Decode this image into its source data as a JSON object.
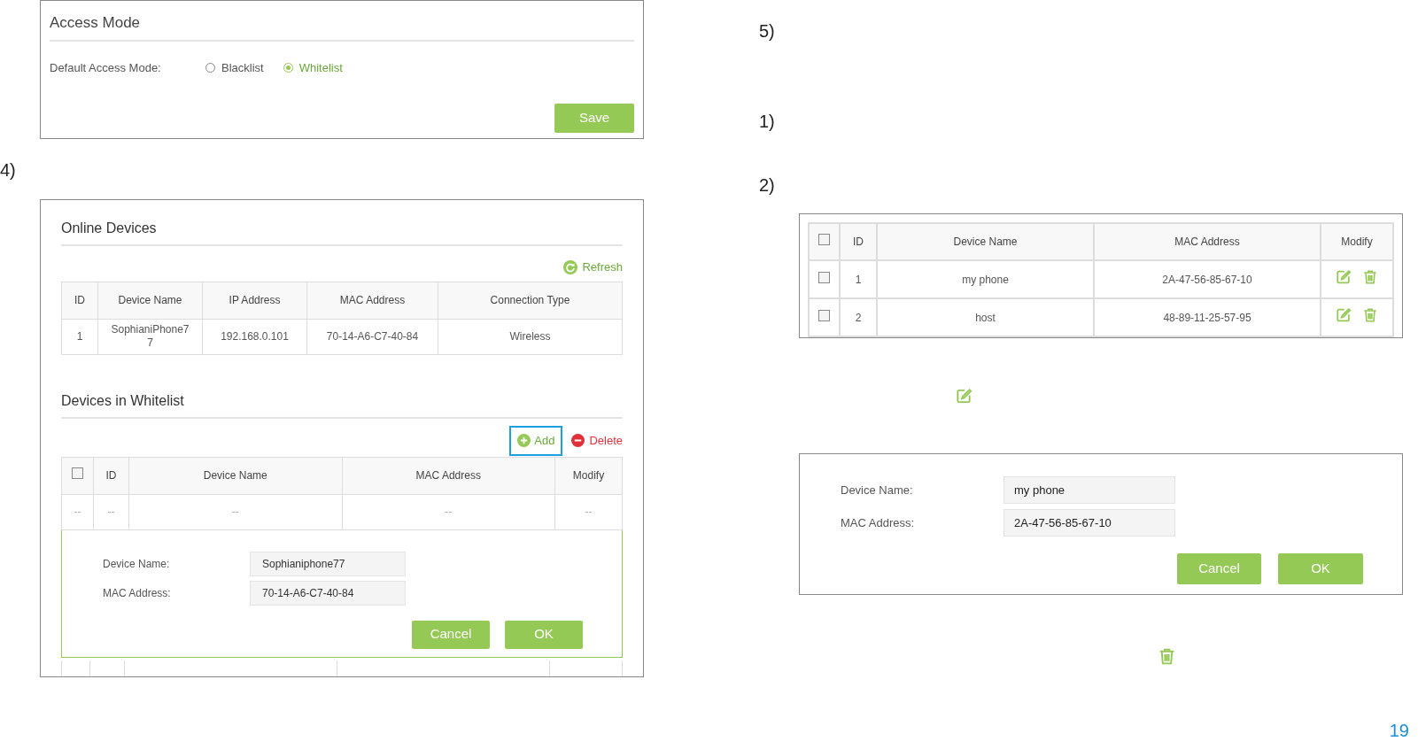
{
  "access_mode": {
    "title": "Access Mode",
    "label": "Default Access Mode:",
    "options": [
      {
        "label": "Blacklist",
        "selected": false
      },
      {
        "label": "Whitelist",
        "selected": true
      }
    ],
    "save": "Save"
  },
  "left_step": "4)",
  "online_devices": {
    "title": "Online Devices",
    "refresh": "Refresh",
    "columns": [
      "ID",
      "Device Name",
      "IP Address",
      "MAC Address",
      "Connection Type"
    ],
    "rows": [
      [
        "1",
        "SophianiPhone77",
        "192.168.0.101",
        "70-14-A6-C7-40-84",
        "Wireless"
      ]
    ]
  },
  "whitelist": {
    "title": "Devices in Whitelist",
    "add": {
      "label": "Add",
      "highlighted": true
    },
    "delete": "Delete",
    "select_all_checked": false,
    "columns": [
      "",
      "ID",
      "Device Name",
      "MAC Address",
      "Modify"
    ],
    "rows": [
      [
        "--",
        "--",
        "--",
        "--",
        "--"
      ]
    ],
    "form": {
      "fields": [
        {
          "label": "Device Name:",
          "value": "Sophianiphone77"
        },
        {
          "label": "MAC Address:",
          "value": "70-14-A6-C7-40-84"
        }
      ],
      "cancel": "Cancel",
      "ok": "OK"
    }
  },
  "right_steps": [
    "5)",
    "1)",
    "2)"
  ],
  "device_table": {
    "select_all_checked": false,
    "columns": [
      "",
      "ID",
      "Device Name",
      "MAC Address",
      "Modify"
    ],
    "rows": [
      {
        "checked": false,
        "id": "1",
        "name": "my phone",
        "mac": "2A-47-56-85-67-10"
      },
      {
        "checked": false,
        "id": "2",
        "name": "host",
        "mac": "48-89-11-25-57-95"
      }
    ]
  },
  "edit_form": {
    "fields": [
      {
        "label": "Device Name:",
        "value": "my phone"
      },
      {
        "label": "MAC Address:",
        "value": "2A-47-56-85-67-10"
      }
    ],
    "cancel": "Cancel",
    "ok": "OK"
  },
  "page_number": "19"
}
